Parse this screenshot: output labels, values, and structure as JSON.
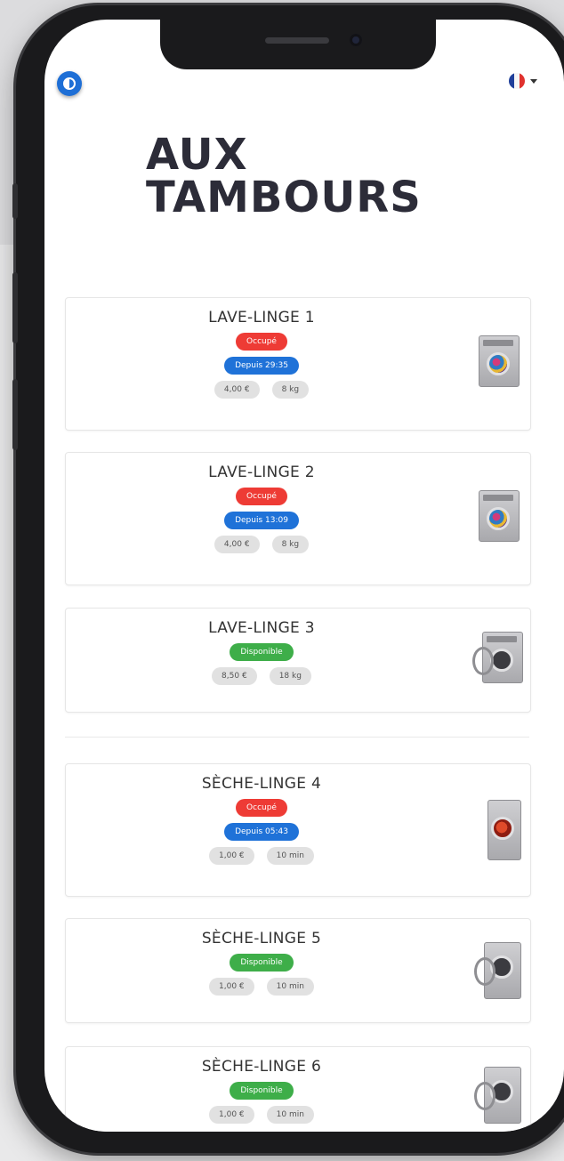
{
  "header": {
    "logo_line1": "AUX",
    "logo_line2": "TAMBOURS"
  },
  "colors": {
    "occupied": "#ee3b35",
    "since": "#1f72d8",
    "available": "#3eae49",
    "chip": "#e1e1e1",
    "toggle": "#1e6fd6"
  },
  "icons": {
    "theme_toggle": "contrast-toggle-icon",
    "language": "france-flag-icon",
    "dropdown": "chevron-down-icon"
  },
  "machines": [
    {
      "name": "LAVE-LINGE 1",
      "status": "Occupé",
      "since": "Depuis 29:35",
      "price": "4,00 €",
      "capacity": "8 kg"
    },
    {
      "name": "LAVE-LINGE 2",
      "status": "Occupé",
      "since": "Depuis 13:09",
      "price": "4,00 €",
      "capacity": "8 kg"
    },
    {
      "name": "LAVE-LINGE 3",
      "status": "Disponible",
      "price": "8,50 €",
      "capacity": "18 kg"
    },
    {
      "name": "SÈCHE-LINGE 4",
      "status": "Occupé",
      "since": "Depuis 05:43",
      "price": "1,00 €",
      "capacity": "10 min"
    },
    {
      "name": "SÈCHE-LINGE 5",
      "status": "Disponible",
      "price": "1,00 €",
      "capacity": "10 min"
    },
    {
      "name": "SÈCHE-LINGE 6",
      "status": "Disponible",
      "price": "1,00 €",
      "capacity": "10 min"
    }
  ]
}
